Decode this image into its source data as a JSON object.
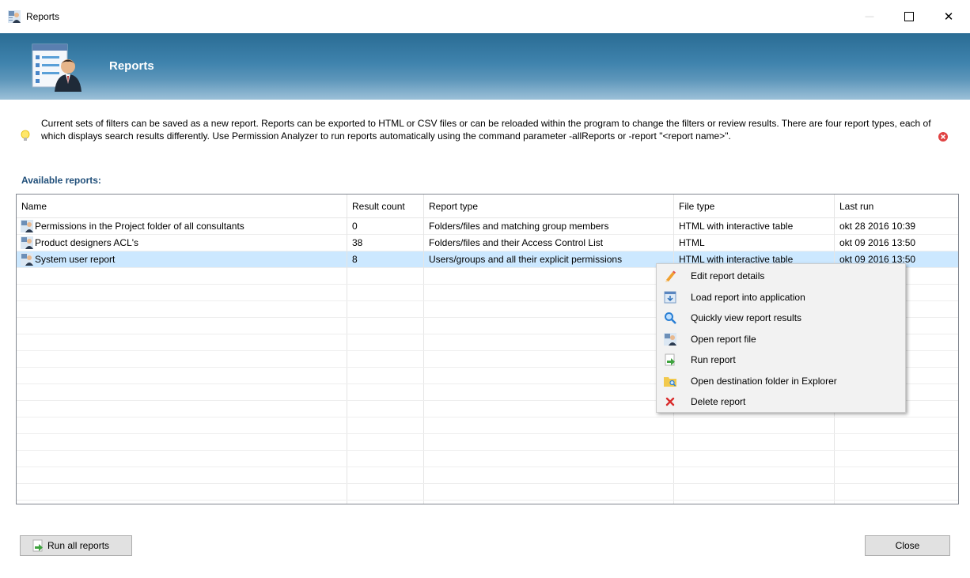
{
  "window": {
    "title": "Reports",
    "min_glyph": "—",
    "close_glyph": "✕"
  },
  "banner": {
    "title": "Reports"
  },
  "info": {
    "text": "Current sets of filters can be saved as a new report. Reports can be exported to HTML or CSV files or can be reloaded within the program to change the filters or review results. There are four report types, each of which displays search results differently. Use Permission Analyzer to run reports automatically using the command parameter -allReports or -report \"<report name>\"."
  },
  "section_label": "Available reports:",
  "table": {
    "columns": [
      "Name",
      "Result count",
      "Report type",
      "File type",
      "Last run"
    ],
    "rows": [
      {
        "name": "Permissions in the Project folder of all consultants",
        "count": "0",
        "type": "Folders/files and matching group members",
        "file_type": "HTML with interactive table",
        "last_run": "okt 28 2016 10:39",
        "selected": false
      },
      {
        "name": "Product designers ACL's",
        "count": "38",
        "type": "Folders/files and their Access Control List",
        "file_type": "HTML",
        "last_run": "okt 09 2016 13:50",
        "selected": false
      },
      {
        "name": "System user report",
        "count": "8",
        "type": "Users/groups and all their explicit permissions",
        "file_type": "HTML with interactive table",
        "last_run": "okt 09 2016 13:50",
        "selected": true
      }
    ]
  },
  "context_menu": {
    "items": [
      {
        "label": "Edit report details",
        "icon": "pencil-icon"
      },
      {
        "label": "Load report into application",
        "icon": "load-report-icon"
      },
      {
        "label": "Quickly view report results",
        "icon": "magnifier-icon"
      },
      {
        "label": "Open report file",
        "icon": "user-report-icon"
      },
      {
        "label": "Run report",
        "icon": "run-arrow-icon"
      },
      {
        "label": "Open destination folder in Explorer",
        "icon": "folder-search-icon"
      },
      {
        "label": "Delete report",
        "icon": "delete-x-icon"
      }
    ]
  },
  "buttons": {
    "run_all": "Run all reports",
    "close": "Close"
  },
  "colors": {
    "banner_top": "#2a6c94",
    "selected_row": "#cce8ff",
    "section_label": "#1f4e79",
    "error_icon": "#e04343"
  }
}
